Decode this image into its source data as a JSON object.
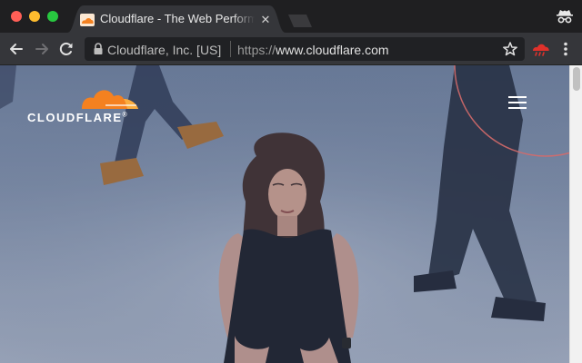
{
  "tab": {
    "title": "Cloudflare - The Web Performance & Security Company",
    "close_glyph": "✕",
    "favicon": "cloudflare-favicon"
  },
  "toolbar": {
    "site_identity": "Cloudflare, Inc. [US]",
    "url_scheme": "https://",
    "url_host": "www.cloudflare.com",
    "icons": [
      "back-arrow-icon",
      "forward-arrow-icon",
      "reload-icon",
      "lock-icon",
      "star-icon",
      "cloudflare-extension-icon",
      "more-menu-icon",
      "incognito-icon"
    ]
  },
  "page": {
    "logo_text": "CLOUDFLARE",
    "logo_mark": "®",
    "menu_icon": "hamburger-menu-icon"
  },
  "colors": {
    "brand_orange": "#f48120",
    "brand_orange_light": "#faad3f",
    "extension_red": "#e0312b",
    "secure_text": "#bdbdbd"
  }
}
